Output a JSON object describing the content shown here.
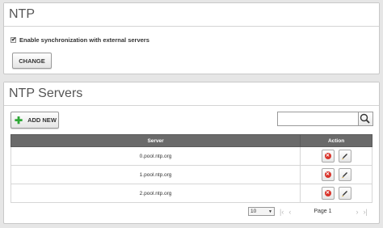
{
  "ntp": {
    "title": "NTP",
    "sync_checked": true,
    "sync_label": "Enable synchronization with external servers",
    "change_label": "CHANGE"
  },
  "servers": {
    "title": "NTP Servers",
    "add_label": "ADD NEW",
    "search_value": "",
    "columns": [
      "Server",
      "Action"
    ],
    "rows": [
      {
        "server": "0.pool.ntp.org"
      },
      {
        "server": "1.pool.ntp.org"
      },
      {
        "server": "2.pool.ntp.org"
      }
    ],
    "pagination": {
      "page_size": "10",
      "page_label": "Page 1"
    }
  },
  "colors": {
    "header_bg": "#6a6a6a",
    "add_icon": "#2ea836",
    "delete_icon": "#d9332a"
  },
  "icons": [
    "check-icon",
    "plus-icon",
    "search-icon",
    "delete-icon",
    "edit-icon",
    "first-page-icon",
    "prev-page-icon",
    "next-page-icon",
    "last-page-icon"
  ]
}
